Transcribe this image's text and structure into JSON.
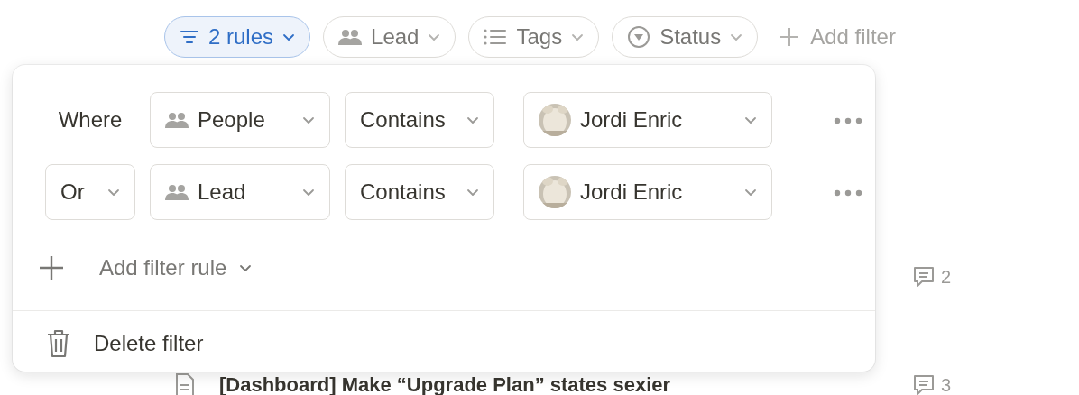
{
  "filter_bar": {
    "chips": [
      {
        "kind": "rules",
        "label": "2 rules",
        "selected": true
      },
      {
        "kind": "people",
        "label": "Lead",
        "selected": false
      },
      {
        "kind": "list",
        "label": "Tags",
        "selected": false
      },
      {
        "kind": "status",
        "label": "Status",
        "selected": false
      }
    ],
    "add_filter": "Add filter"
  },
  "filter_popup": {
    "rules": [
      {
        "kind": "label",
        "conjunction": "Where",
        "property": "People",
        "operator": "Contains",
        "value": "Jordi Enric"
      },
      {
        "kind": "dropdown",
        "conjunction": "Or",
        "property": "Lead",
        "operator": "Contains",
        "value": "Jordi Enric"
      }
    ],
    "add_rule": "Add filter rule",
    "delete": "Delete filter"
  },
  "list": {
    "rows": [
      {
        "comments": "2"
      },
      {
        "title": "[Dashboard] Make “Upgrade Plan” states sexier",
        "comments": "3"
      }
    ]
  }
}
